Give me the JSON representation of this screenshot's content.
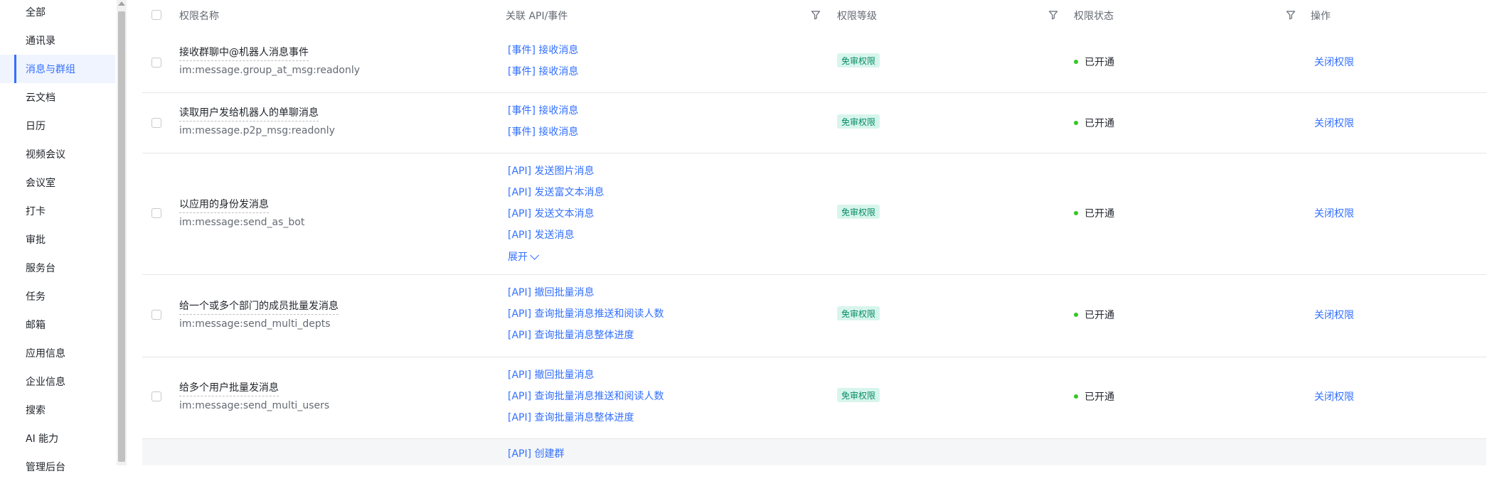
{
  "sidebar": {
    "items": [
      {
        "label": "全部"
      },
      {
        "label": "通讯录"
      },
      {
        "label": "消息与群组"
      },
      {
        "label": "云文档"
      },
      {
        "label": "日历"
      },
      {
        "label": "视频会议"
      },
      {
        "label": "会议室"
      },
      {
        "label": "打卡"
      },
      {
        "label": "审批"
      },
      {
        "label": "服务台"
      },
      {
        "label": "任务"
      },
      {
        "label": "邮箱"
      },
      {
        "label": "应用信息"
      },
      {
        "label": "企业信息"
      },
      {
        "label": "搜索"
      },
      {
        "label": "AI 能力"
      },
      {
        "label": "管理后台"
      }
    ],
    "active_index": 2
  },
  "table": {
    "headers": {
      "name": "权限名称",
      "api": "关联 API/事件",
      "level": "权限等级",
      "status": "权限状态",
      "action": "操作"
    },
    "rows": [
      {
        "name": "接收群聊中@机器人消息事件",
        "code": "im:message.group_at_msg:readonly",
        "apis": [
          "[事件] 接收消息",
          "[事件] 接收消息"
        ],
        "level": "免审权限",
        "status": "已开通",
        "action": "关闭权限"
      },
      {
        "name": "读取用户发给机器人的单聊消息",
        "code": "im:message.p2p_msg:readonly",
        "apis": [
          "[事件] 接收消息",
          "[事件] 接收消息"
        ],
        "level": "免审权限",
        "status": "已开通",
        "action": "关闭权限"
      },
      {
        "name": "以应用的身份发消息",
        "code": "im:message:send_as_bot",
        "apis": [
          "[API] 发送图片消息",
          "[API] 发送富文本消息",
          "[API] 发送文本消息",
          "[API] 发送消息"
        ],
        "expand": "展开",
        "level": "免审权限",
        "status": "已开通",
        "action": "关闭权限"
      },
      {
        "name": "给一个或多个部门的成员批量发消息",
        "code": "im:message:send_multi_depts",
        "apis": [
          "[API] 撤回批量消息",
          "[API] 查询批量消息推送和阅读人数",
          "[API] 查询批量消息整体进度"
        ],
        "level": "免审权限",
        "status": "已开通",
        "action": "关闭权限"
      },
      {
        "name": "给多个用户批量发消息",
        "code": "im:message:send_multi_users",
        "apis": [
          "[API] 撤回批量消息",
          "[API] 查询批量消息推送和阅读人数",
          "[API] 查询批量消息整体进度"
        ],
        "level": "免审权限",
        "status": "已开通",
        "action": "关闭权限"
      },
      {
        "apis": [
          "[API] 创建群"
        ]
      }
    ]
  },
  "colors": {
    "accent": "#3370ff",
    "badge_bg": "#d7f5ec",
    "badge_text": "#078a64",
    "status_dot": "#34c724"
  }
}
